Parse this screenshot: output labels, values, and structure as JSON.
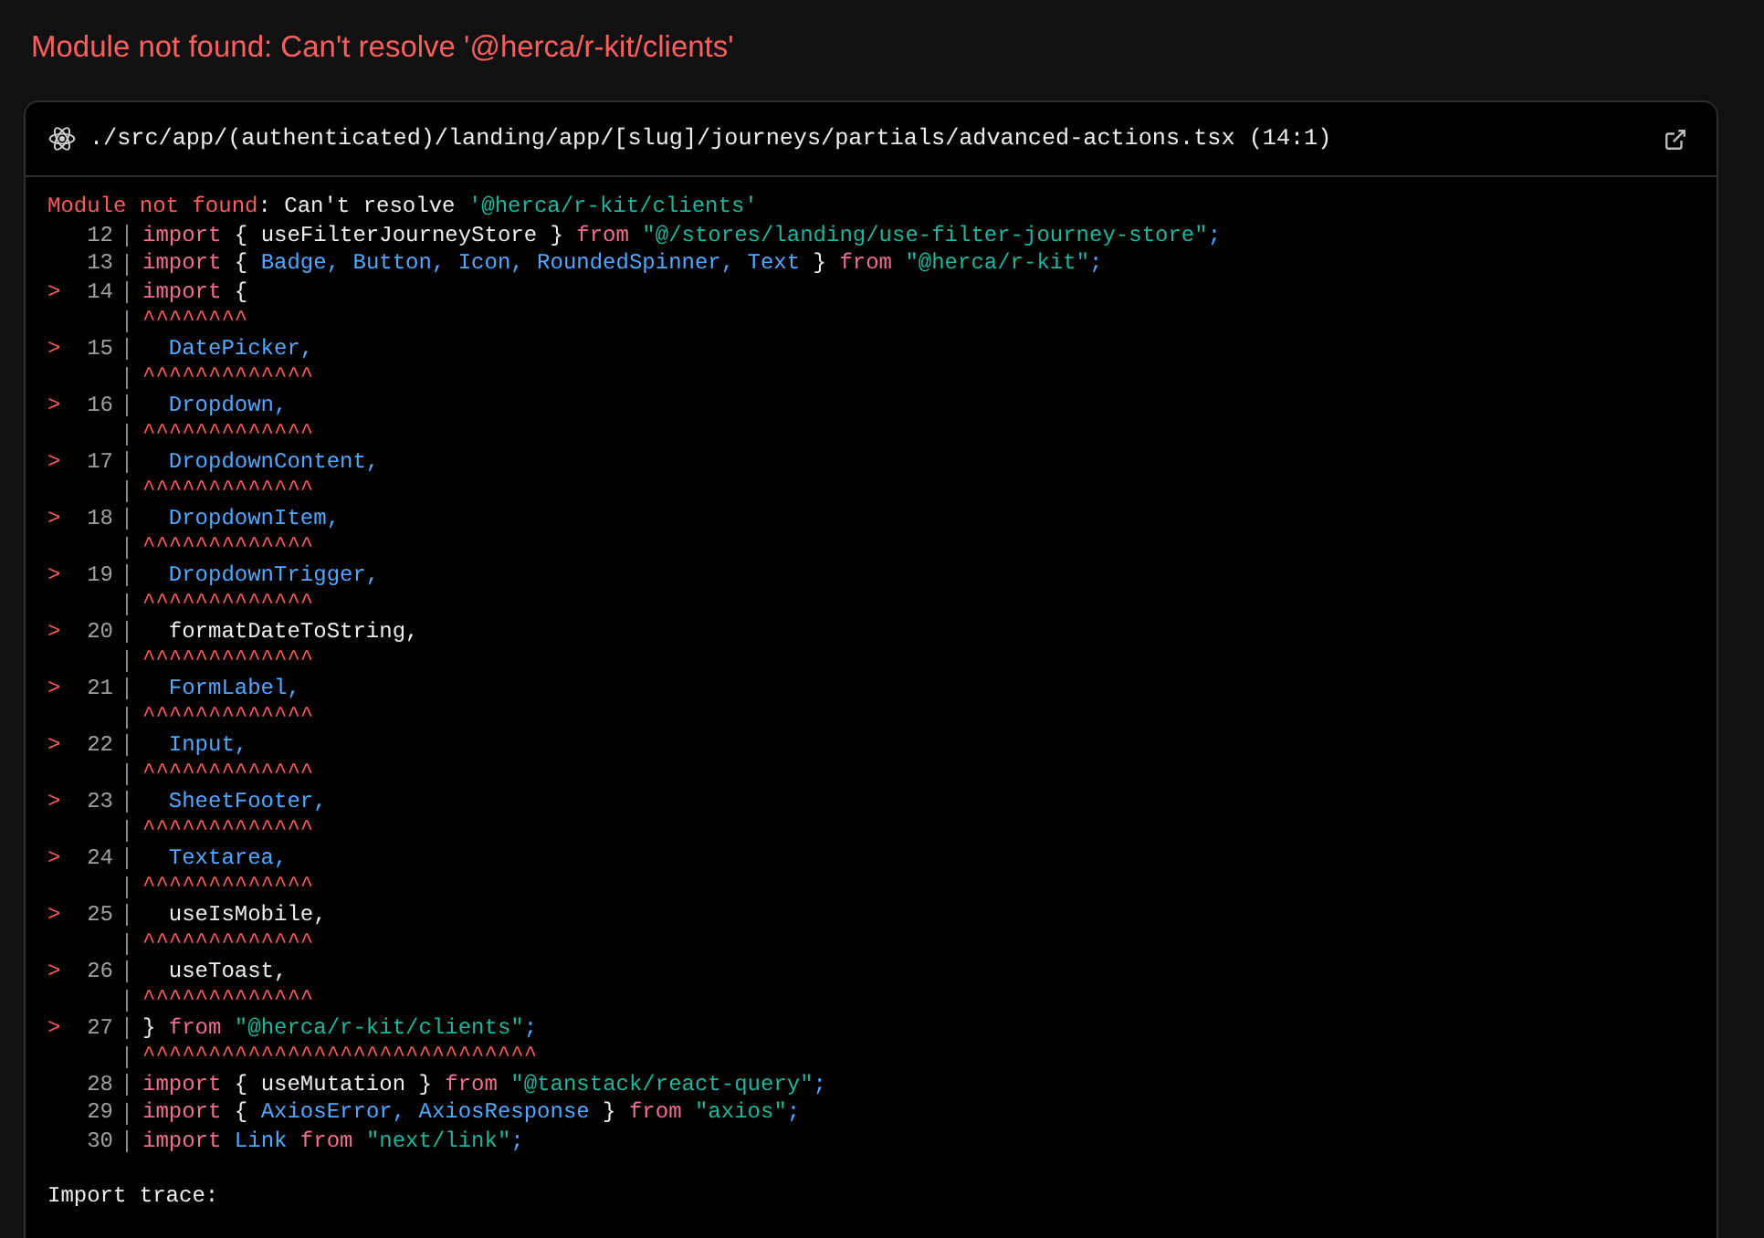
{
  "error_title": "Module not found: Can't resolve '@herca/r-kit/clients'",
  "source": {
    "path": "./src/app/(authenticated)/landing/app/[slug]/journeys/partials/advanced-actions.tsx (14:1)"
  },
  "message": [
    {
      "kind": "error",
      "text": "Module not found"
    },
    {
      "kind": "plain",
      "text": ": Can't resolve "
    },
    {
      "kind": "string",
      "text": "'@herca/r-kit/clients'"
    }
  ],
  "lines": [
    {
      "kind": "code",
      "number": "12",
      "tokens": [
        {
          "kind": "keyword",
          "text": "import"
        },
        {
          "kind": "plain",
          "text": " { useFilterJourneyStore } "
        },
        {
          "kind": "keyword",
          "text": "from"
        },
        {
          "kind": "string",
          "text": " \"@/stores/landing/use-filter-journey-store\""
        },
        {
          "kind": "identifier",
          "text": ";"
        }
      ]
    },
    {
      "kind": "code",
      "number": "13",
      "tokens": [
        {
          "kind": "keyword",
          "text": "import"
        },
        {
          "kind": "plain",
          "text": " { "
        },
        {
          "kind": "identifier",
          "text": "Badge, Button, Icon, RoundedSpinner, Text"
        },
        {
          "kind": "plain",
          "text": " } "
        },
        {
          "kind": "keyword",
          "text": "from"
        },
        {
          "kind": "string",
          "text": " \"@herca/r-kit\""
        },
        {
          "kind": "identifier",
          "text": ";"
        }
      ]
    },
    {
      "kind": "code",
      "marker": ">",
      "number": "14",
      "tokens": [
        {
          "kind": "keyword",
          "text": "import"
        },
        {
          "kind": "plain",
          "text": " {"
        }
      ]
    },
    {
      "kind": "caret",
      "carets": "^^^^^^^^"
    },
    {
      "kind": "code",
      "marker": ">",
      "number": "15",
      "tokens": [
        {
          "kind": "identifier",
          "text": "  DatePicker,"
        }
      ]
    },
    {
      "kind": "caret",
      "carets": "^^^^^^^^^^^^^"
    },
    {
      "kind": "code",
      "marker": ">",
      "number": "16",
      "tokens": [
        {
          "kind": "identifier",
          "text": "  Dropdown,"
        }
      ]
    },
    {
      "kind": "caret",
      "carets": "^^^^^^^^^^^^^"
    },
    {
      "kind": "code",
      "marker": ">",
      "number": "17",
      "tokens": [
        {
          "kind": "identifier",
          "text": "  DropdownContent,"
        }
      ]
    },
    {
      "kind": "caret",
      "carets": "^^^^^^^^^^^^^"
    },
    {
      "kind": "code",
      "marker": ">",
      "number": "18",
      "tokens": [
        {
          "kind": "identifier",
          "text": "  DropdownItem,"
        }
      ]
    },
    {
      "kind": "caret",
      "carets": "^^^^^^^^^^^^^"
    },
    {
      "kind": "code",
      "marker": ">",
      "number": "19",
      "tokens": [
        {
          "kind": "identifier",
          "text": "  DropdownTrigger,"
        }
      ]
    },
    {
      "kind": "caret",
      "carets": "^^^^^^^^^^^^^"
    },
    {
      "kind": "code",
      "marker": ">",
      "number": "20",
      "tokens": [
        {
          "kind": "plain",
          "text": "  formatDateToString,"
        }
      ]
    },
    {
      "kind": "caret",
      "carets": "^^^^^^^^^^^^^"
    },
    {
      "kind": "code",
      "marker": ">",
      "number": "21",
      "tokens": [
        {
          "kind": "identifier",
          "text": "  FormLabel,"
        }
      ]
    },
    {
      "kind": "caret",
      "carets": "^^^^^^^^^^^^^"
    },
    {
      "kind": "code",
      "marker": ">",
      "number": "22",
      "tokens": [
        {
          "kind": "identifier",
          "text": "  Input,"
        }
      ]
    },
    {
      "kind": "caret",
      "carets": "^^^^^^^^^^^^^"
    },
    {
      "kind": "code",
      "marker": ">",
      "number": "23",
      "tokens": [
        {
          "kind": "identifier",
          "text": "  SheetFooter,"
        }
      ]
    },
    {
      "kind": "caret",
      "carets": "^^^^^^^^^^^^^"
    },
    {
      "kind": "code",
      "marker": ">",
      "number": "24",
      "tokens": [
        {
          "kind": "identifier",
          "text": "  Textarea,"
        }
      ]
    },
    {
      "kind": "caret",
      "carets": "^^^^^^^^^^^^^"
    },
    {
      "kind": "code",
      "marker": ">",
      "number": "25",
      "tokens": [
        {
          "kind": "plain",
          "text": "  useIsMobile,"
        }
      ]
    },
    {
      "kind": "caret",
      "carets": "^^^^^^^^^^^^^"
    },
    {
      "kind": "code",
      "marker": ">",
      "number": "26",
      "tokens": [
        {
          "kind": "plain",
          "text": "  useToast,"
        }
      ]
    },
    {
      "kind": "caret",
      "carets": "^^^^^^^^^^^^^"
    },
    {
      "kind": "code",
      "marker": ">",
      "number": "27",
      "tokens": [
        {
          "kind": "plain",
          "text": "} "
        },
        {
          "kind": "keyword",
          "text": "from"
        },
        {
          "kind": "string",
          "text": " \"@herca/r-kit/clients\""
        },
        {
          "kind": "identifier",
          "text": ";"
        }
      ]
    },
    {
      "kind": "caret",
      "carets": "^^^^^^^^^^^^^^^^^^^^^^^^^^^^^^"
    },
    {
      "kind": "code",
      "number": "28",
      "tokens": [
        {
          "kind": "keyword",
          "text": "import"
        },
        {
          "kind": "plain",
          "text": " { useMutation } "
        },
        {
          "kind": "keyword",
          "text": "from"
        },
        {
          "kind": "string",
          "text": " \"@tanstack/react-query\""
        },
        {
          "kind": "identifier",
          "text": ";"
        }
      ]
    },
    {
      "kind": "code",
      "number": "29",
      "tokens": [
        {
          "kind": "keyword",
          "text": "import"
        },
        {
          "kind": "plain",
          "text": " { "
        },
        {
          "kind": "identifier",
          "text": "AxiosError, AxiosResponse"
        },
        {
          "kind": "plain",
          "text": " } "
        },
        {
          "kind": "keyword",
          "text": "from"
        },
        {
          "kind": "string",
          "text": " \"axios\""
        },
        {
          "kind": "identifier",
          "text": ";"
        }
      ]
    },
    {
      "kind": "code",
      "number": "30",
      "tokens": [
        {
          "kind": "keyword",
          "text": "import"
        },
        {
          "kind": "identifier",
          "text": " Link"
        },
        {
          "kind": "keyword",
          "text": " from"
        },
        {
          "kind": "string",
          "text": " \"next/link\""
        },
        {
          "kind": "identifier",
          "text": ";"
        }
      ]
    }
  ],
  "trace_heading": "Import trace:"
}
